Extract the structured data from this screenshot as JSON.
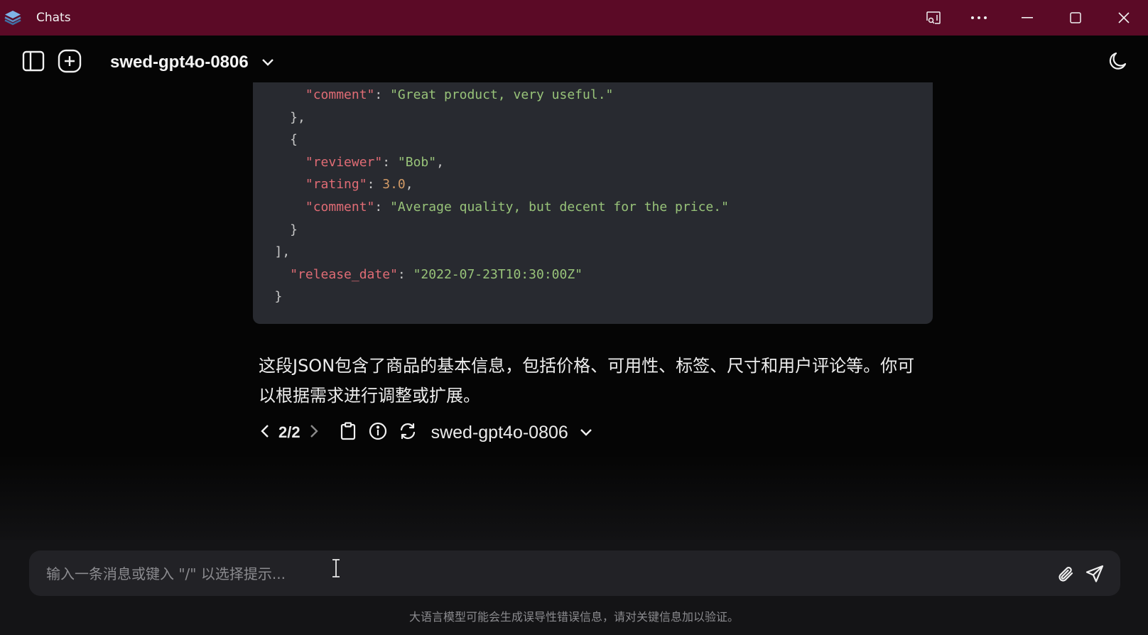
{
  "window": {
    "title": "Chats",
    "titlebar_color": "#5b0a26"
  },
  "header": {
    "model_name": "swed-gpt4o-0806"
  },
  "code_block": {
    "lines": [
      [
        [
          "p",
          "    "
        ],
        [
          "k",
          "\"comment\""
        ],
        [
          "p",
          ": "
        ],
        [
          "s",
          "\"Great product, very useful.\""
        ]
      ],
      [
        [
          "p",
          "  },"
        ]
      ],
      [
        [
          "p",
          "  {"
        ]
      ],
      [
        [
          "p",
          "    "
        ],
        [
          "k",
          "\"reviewer\""
        ],
        [
          "p",
          ": "
        ],
        [
          "s",
          "\"Bob\""
        ],
        [
          "p",
          ","
        ]
      ],
      [
        [
          "p",
          "    "
        ],
        [
          "k",
          "\"rating\""
        ],
        [
          "p",
          ": "
        ],
        [
          "n",
          "3.0"
        ],
        [
          "p",
          ","
        ]
      ],
      [
        [
          "p",
          "    "
        ],
        [
          "k",
          "\"comment\""
        ],
        [
          "p",
          ": "
        ],
        [
          "s",
          "\"Average quality, but decent for the price.\""
        ]
      ],
      [
        [
          "p",
          "  }"
        ]
      ],
      [
        [
          "p",
          "],"
        ]
      ],
      [
        [
          "p",
          "  "
        ],
        [
          "k",
          "\"release_date\""
        ],
        [
          "p",
          ": "
        ],
        [
          "s",
          "\"2022-07-23T10:30:00Z\""
        ]
      ],
      [
        [
          "p",
          "}"
        ]
      ]
    ]
  },
  "answer": {
    "text": "这段JSON包含了商品的基本信息，包括价格、可用性、标签、尺寸和用户评论等。你可以根据需求进行调整或扩展。"
  },
  "message_actions": {
    "pager": "2/2",
    "model_name": "swed-gpt4o-0806"
  },
  "composer": {
    "placeholder": "输入一条消息或键入 \"/\" 以选择提示...",
    "value": ""
  },
  "footer": {
    "disclaimer": "大语言模型可能会生成误导性错误信息，请对关键信息加以验证。"
  }
}
